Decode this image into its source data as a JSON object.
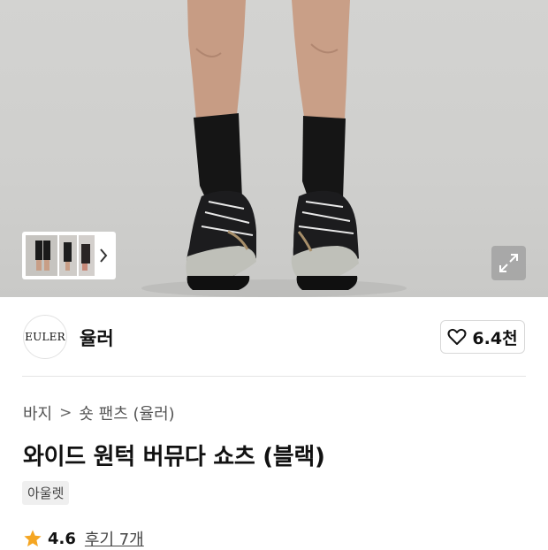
{
  "hero": {
    "image": "product-photo-legs-wearing-socks-and-sneakers",
    "thumbnail_count": 3
  },
  "brand": {
    "logo_text": "EULER",
    "name": "율러"
  },
  "like": {
    "count": "6.4천"
  },
  "breadcrumb": {
    "category": "바지",
    "subcategory": "숏 팬츠 (율러)"
  },
  "product": {
    "title": "와이드 원턱 버뮤다 쇼츠 (블랙)",
    "tag": "아울렛"
  },
  "rating": {
    "score": "4.6",
    "reviews_label": "후기 7개"
  },
  "colors": {
    "star": "#f5a623",
    "text": "#111111"
  }
}
